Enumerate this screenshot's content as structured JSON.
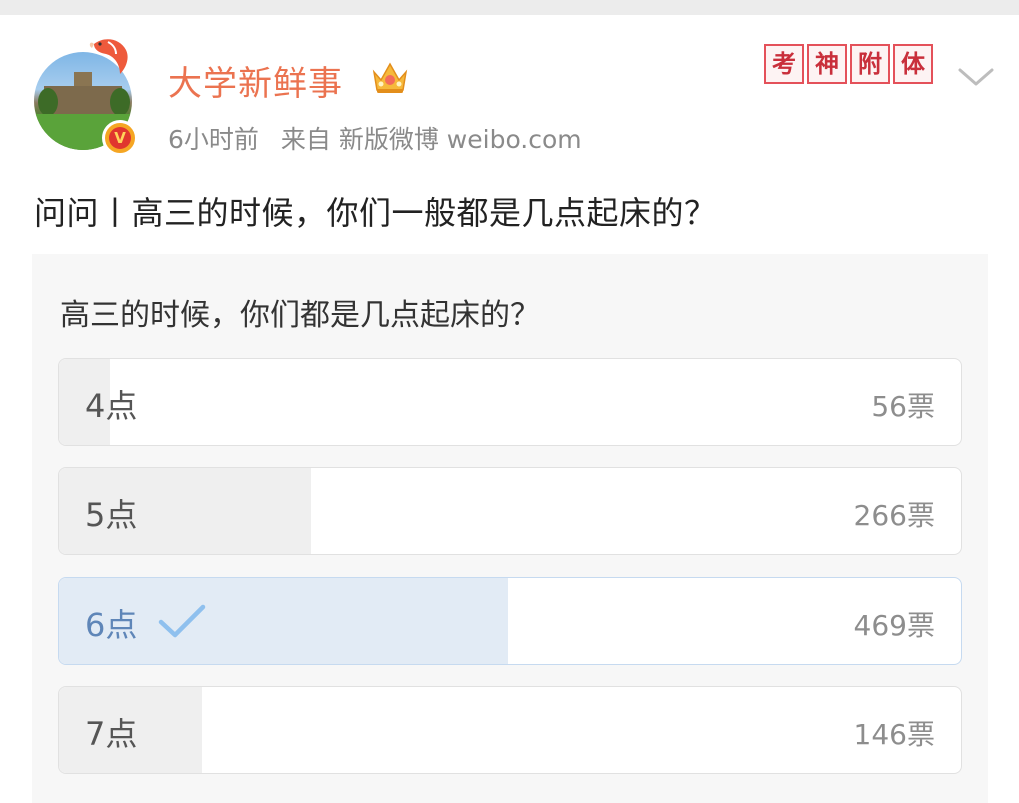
{
  "post": {
    "username": "大学新鲜事",
    "time": "6小时前",
    "source": "来自 新版微博 weibo.com",
    "badge_text": "V",
    "stamp_chars": [
      "考",
      "神",
      "附",
      "体"
    ],
    "text": "问问丨高三的时候，你们一般都是几点起床的？"
  },
  "poll": {
    "question": "高三的时候，你们都是几点起床的？",
    "options": [
      {
        "label": "4点",
        "votes": "56票",
        "share": 0.056,
        "selected": false
      },
      {
        "label": "5点",
        "votes": "266票",
        "share": 0.279,
        "selected": false
      },
      {
        "label": "6点",
        "votes": "469票",
        "share": 0.498,
        "selected": true
      },
      {
        "label": "7点",
        "votes": "146票",
        "share": 0.159,
        "selected": false
      }
    ]
  },
  "colors": {
    "username": "#eb7350",
    "selected_fill": "#e2ebf5",
    "selected_text": "#5f86b8",
    "bar_fill": "#efefef",
    "check": "#8fc0ee"
  },
  "icons": {
    "crown": "crown-icon",
    "verified": "verified-badge-icon",
    "chevron": "chevron-down-icon",
    "check": "checkmark-icon"
  }
}
